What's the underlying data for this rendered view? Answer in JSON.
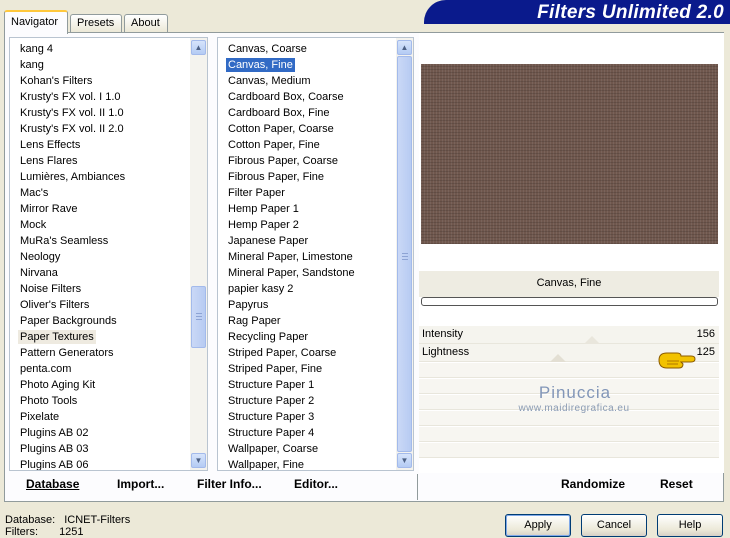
{
  "window": {
    "title": "Filters Unlimited 2.0",
    "tabs": [
      {
        "label": "Navigator",
        "active": true
      },
      {
        "label": "Presets",
        "active": false
      },
      {
        "label": "About",
        "active": false
      }
    ]
  },
  "categories": {
    "items": [
      "kang 4",
      "kang",
      "Kohan's Filters",
      "Krusty's FX vol. I 1.0",
      "Krusty's FX vol. II 1.0",
      "Krusty's FX vol. II 2.0",
      "Lens Effects",
      "Lens Flares",
      "Lumières, Ambiances",
      "Mac's",
      "Mirror Rave",
      "Mock",
      "MuRa's Seamless",
      "Neology",
      "Nirvana",
      "Noise Filters",
      "Oliver's Filters",
      "Paper Backgrounds",
      "Paper Textures",
      "Pattern Generators",
      "penta.com",
      "Photo Aging Kit",
      "Photo Tools",
      "Pixelate",
      "Plugins AB 02",
      "Plugins AB 03",
      "Plugins AB 06"
    ],
    "selected": "Paper Textures",
    "scroll_position": 0.67
  },
  "filters": {
    "items": [
      "Canvas, Coarse",
      "Canvas, Fine",
      "Canvas, Medium",
      "Cardboard Box, Coarse",
      "Cardboard Box, Fine",
      "Cotton Paper, Coarse",
      "Cotton Paper, Fine",
      "Fibrous Paper, Coarse",
      "Fibrous Paper, Fine",
      "Filter Paper",
      "Hemp Paper 1",
      "Hemp Paper 2",
      "Japanese Paper",
      "Mineral Paper, Limestone",
      "Mineral Paper, Sandstone",
      "papier kasy 2",
      "Papyrus",
      "Rag Paper",
      "Recycling Paper",
      "Striped Paper, Coarse",
      "Striped Paper, Fine",
      "Structure Paper 1",
      "Structure Paper 2",
      "Structure Paper 3",
      "Structure Paper 4",
      "Wallpaper, Coarse",
      "Wallpaper, Fine"
    ],
    "selected": "Canvas, Fine"
  },
  "preview": {
    "filter_name": "Canvas, Fine",
    "texture_color": "#6f574d"
  },
  "parameters": [
    {
      "label": "Intensity",
      "value": "156",
      "level": 0.612
    },
    {
      "label": "Lightness",
      "value": "125",
      "level": 0.49
    }
  ],
  "watermark": {
    "name": "Pinuccia",
    "url": "www.maidiregrafica.eu"
  },
  "toolbar": {
    "database": "Database",
    "import": "Import...",
    "filter_info": "Filter Info...",
    "editor": "Editor...",
    "randomize": "Randomize",
    "reset": "Reset"
  },
  "status": {
    "database_label": "Database:",
    "database_value": "ICNET-Filters",
    "filters_label": "Filters:",
    "filters_value": "1251"
  },
  "buttons": {
    "apply": "Apply",
    "cancel": "Cancel",
    "help": "Help"
  },
  "colors": {
    "banner": "#0a1a8c",
    "selection": "#316ac5"
  }
}
